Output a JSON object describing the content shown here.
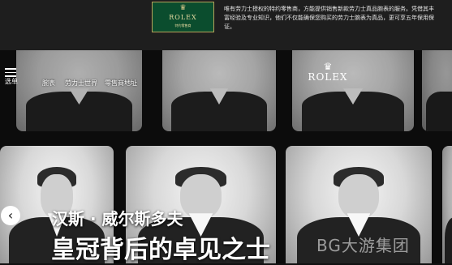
{
  "retailer_badge": {
    "crown": "♛",
    "brand": "ROLEX",
    "subtitle": "特约零售商"
  },
  "notice": {
    "text": "唯有劳力士授权的特约零售商，方能提供销售新款劳力士真品腕表的服务。凭借其丰富经验及专业知识，他们不仅能确保您购买的劳力士腕表为真品，更可享五年保用保证。"
  },
  "nav": {
    "menu_label": "选单",
    "links": [
      "腕表",
      "劳力士世界",
      "零售商地址"
    ],
    "logo_crown": "♛",
    "logo_text": "ROLEX"
  },
  "hero": {
    "kicker": "汉斯 · 威尔斯多夫",
    "headline": "皇冠背后的卓见之士",
    "prev_arrow": "‹"
  },
  "watermark": "BG大游集团",
  "colors": {
    "badge_green": "#0b4d2e",
    "gold": "#b6a25a",
    "topbar": "#1e1e1e"
  }
}
